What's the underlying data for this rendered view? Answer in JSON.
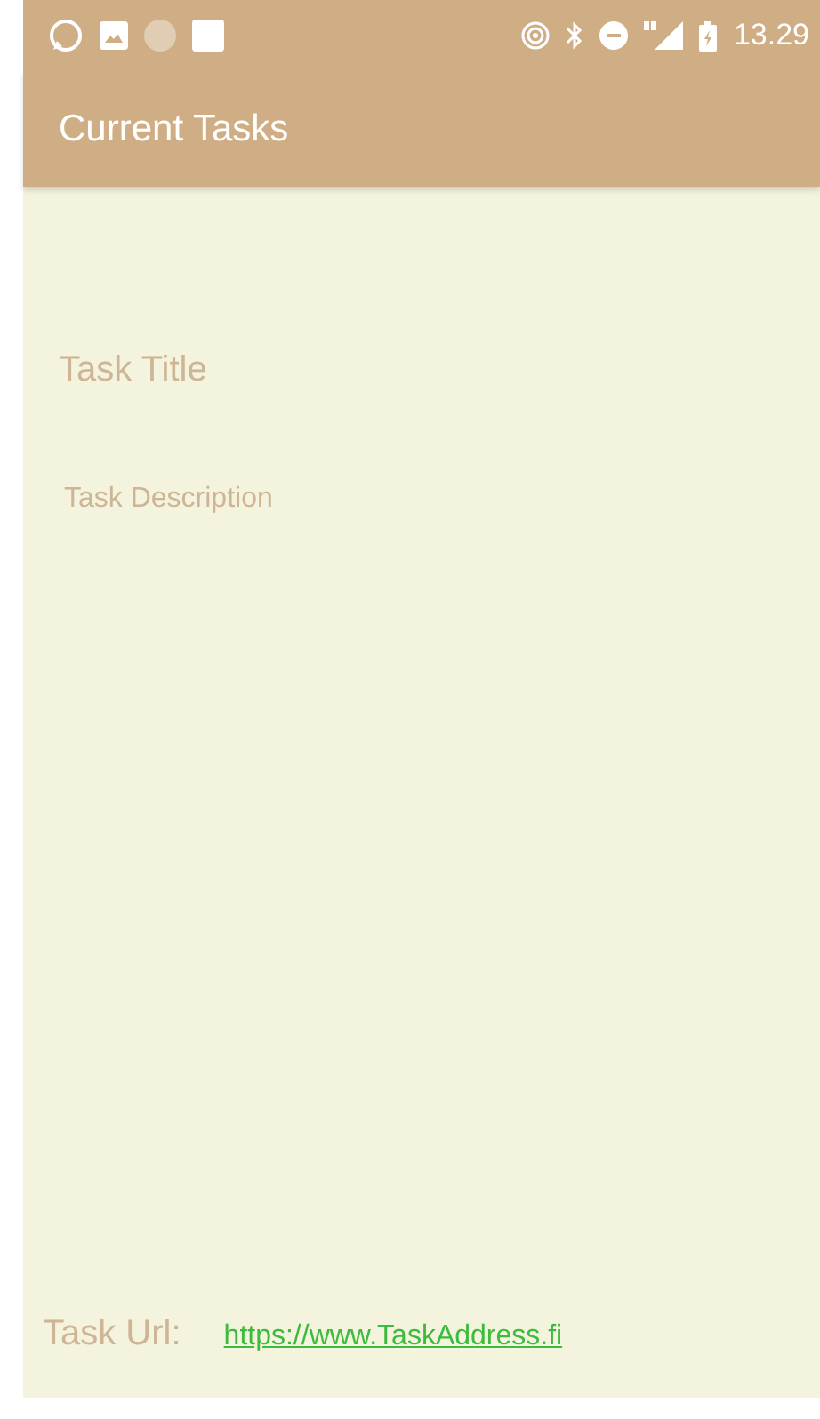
{
  "status_bar": {
    "time": "13.29"
  },
  "app_bar": {
    "title": "Current Tasks"
  },
  "task": {
    "title": "Task Title",
    "description": "Task Description",
    "url_label": "Task Url:",
    "url": "https://www.TaskAddress.fi"
  }
}
